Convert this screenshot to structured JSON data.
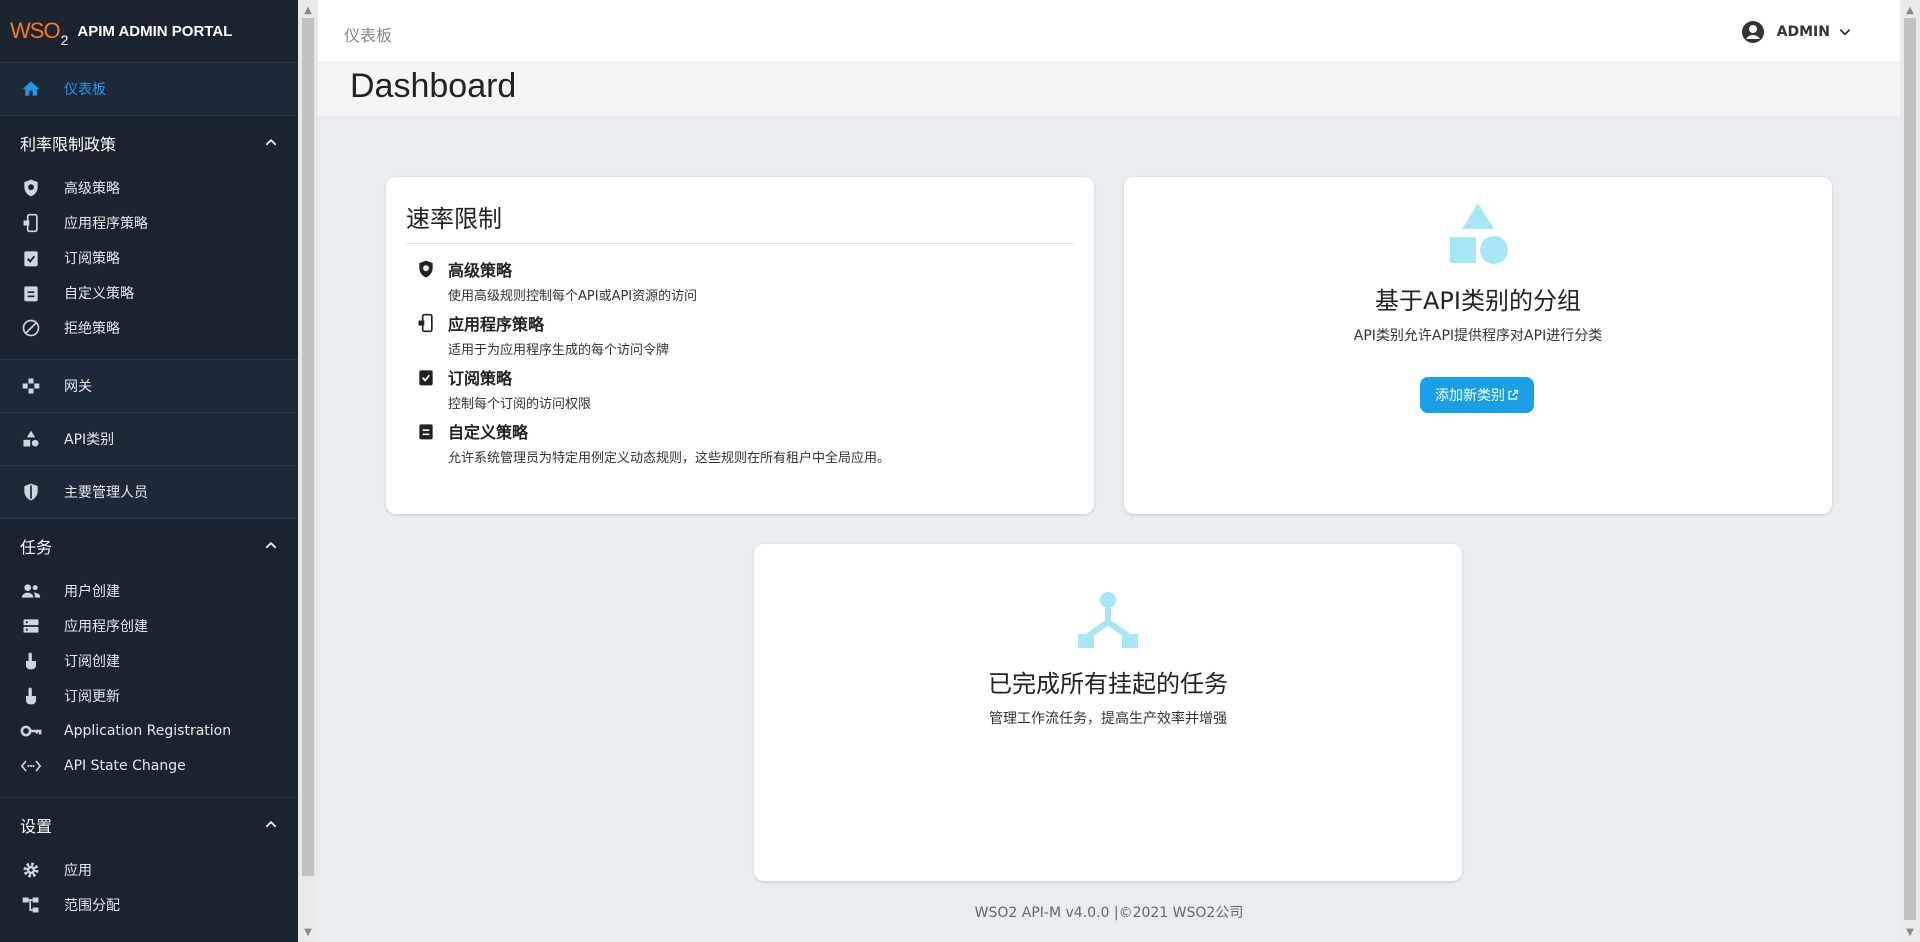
{
  "app": {
    "logo_text": "WSO",
    "logo_sub": "2",
    "title": "APIM ADMIN PORTAL"
  },
  "sidebar": {
    "dashboard": "仪表板",
    "rate_section": {
      "header": "利率限制政策",
      "items": [
        "高级策略",
        "应用程序策略",
        "订阅策略",
        "自定义策略",
        "拒绝策略"
      ]
    },
    "gateway": "网关",
    "api_categories": "API类别",
    "key_managers": "主要管理人员",
    "tasks_section": {
      "header": "任务",
      "items": [
        "用户创建",
        "应用程序创建",
        "订阅创建",
        "订阅更新",
        "Application Registration",
        "API State Change"
      ]
    },
    "settings_section": {
      "header": "设置",
      "items": [
        "应用",
        "范围分配"
      ]
    }
  },
  "topbar": {
    "breadcrumb": "仪表板",
    "user": "ADMIN"
  },
  "main": {
    "page_title": "Dashboard",
    "rate_card": {
      "title": "速率限制",
      "policies": [
        {
          "title": "高级策略",
          "desc": "使用高级规则控制每个API或API资源的访问"
        },
        {
          "title": "应用程序策略",
          "desc": "适用于为应用程序生成的每个访问令牌"
        },
        {
          "title": "订阅策略",
          "desc": "控制每个订阅的访问权限"
        },
        {
          "title": "自定义策略",
          "desc": "允许系统管理员为特定用例定义动态规则，这些规则在所有租户中全局应用。"
        }
      ]
    },
    "category_card": {
      "title": "基于API类别的分组",
      "desc": "API类别允许API提供程序对API进行分类",
      "button": "添加新类别"
    },
    "task_card": {
      "title": "已完成所有挂起的任务",
      "desc": "管理工作流任务，提高生产效率并增强"
    },
    "footer": "WSO2 API-M v4.0.0 |©2021 WSO2公司"
  },
  "colors": {
    "sidebar_bg": "#1a2330",
    "accent": "#2196f3",
    "button": "#1a9fe4",
    "illustration": "#a6e6f5"
  }
}
